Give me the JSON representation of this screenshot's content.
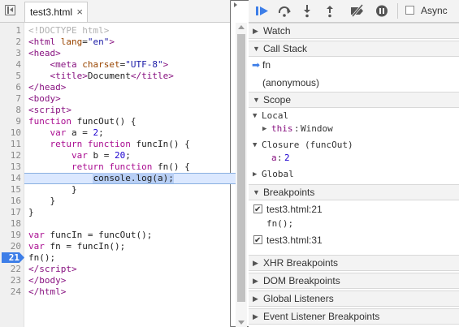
{
  "editor": {
    "tab_label": "test3.html",
    "tab_close": "×",
    "lines": [
      {
        "n": "1",
        "html": "<span class=\"c-comment\">&lt;!DOCTYPE html&gt;</span>"
      },
      {
        "n": "2",
        "html": "<span class=\"c-tag\">&lt;html</span> <span class=\"c-attr\">lang</span>=<span class=\"c-str\">\"en\"</span><span class=\"c-tag\">&gt;</span>"
      },
      {
        "n": "3",
        "html": "<span class=\"c-tag\">&lt;head&gt;</span>"
      },
      {
        "n": "4",
        "html": "    <span class=\"c-tag\">&lt;meta</span> <span class=\"c-attr\">charset</span>=<span class=\"c-str\">\"UTF-8\"</span><span class=\"c-tag\">&gt;</span>"
      },
      {
        "n": "5",
        "html": "    <span class=\"c-tag\">&lt;title&gt;</span>Document<span class=\"c-tag\">&lt;/title&gt;</span>"
      },
      {
        "n": "6",
        "html": "<span class=\"c-tag\">&lt;/head&gt;</span>"
      },
      {
        "n": "7",
        "html": "<span class=\"c-tag\">&lt;body&gt;</span>"
      },
      {
        "n": "8",
        "html": "<span class=\"c-tag\">&lt;script&gt;</span>"
      },
      {
        "n": "9",
        "html": "<span class=\"c-kw\">function</span> funcOut() {"
      },
      {
        "n": "10",
        "html": "    <span class=\"c-kw\">var</span> a = <span class=\"c-num\">2</span>;"
      },
      {
        "n": "11",
        "html": "    <span class=\"c-kw\">return</span> <span class=\"c-kw\">function</span> funcIn() {"
      },
      {
        "n": "12",
        "html": "        <span class=\"c-kw\">var</span> b = <span class=\"c-num\">20</span>;"
      },
      {
        "n": "13",
        "html": "        <span class=\"c-kw\">return</span> <span class=\"c-kw\">function</span> fn() {"
      },
      {
        "n": "14",
        "html": "            <span class=\"sel\">console.log(a);</span>",
        "hl": true
      },
      {
        "n": "15",
        "html": "        }"
      },
      {
        "n": "16",
        "html": "    }"
      },
      {
        "n": "17",
        "html": "}"
      },
      {
        "n": "18",
        "html": ""
      },
      {
        "n": "19",
        "html": "<span class=\"c-kw\">var</span> funcIn = funcOut();"
      },
      {
        "n": "20",
        "html": "<span class=\"c-kw\">var</span> fn = funcIn();"
      },
      {
        "n": "21",
        "html": "fn();",
        "bp": true
      },
      {
        "n": "22",
        "html": "<span class=\"c-tag\">&lt;/script&gt;</span>"
      },
      {
        "n": "23",
        "html": "<span class=\"c-tag\">&lt;/body&gt;</span>"
      },
      {
        "n": "24",
        "html": "<span class=\"c-tag\">&lt;/html&gt;</span>"
      }
    ]
  },
  "toolbar": {
    "async_label": "Async",
    "icons": [
      "resume-icon",
      "step-over-icon",
      "step-into-icon",
      "step-out-icon",
      "deactivate-breakpoints-icon",
      "pause-on-exceptions-icon"
    ]
  },
  "panes": {
    "watch": "Watch",
    "call_stack": "Call Stack",
    "call_stack_frames": [
      "fn",
      "(anonymous)"
    ],
    "scope": "Scope",
    "scope_local": "Local",
    "scope_this_key": "this",
    "scope_this_val": "Window",
    "scope_closure": "Closure (funcOut)",
    "scope_a_key": "a",
    "scope_a_val": "2",
    "scope_global": "Global",
    "breakpoints": "Breakpoints",
    "bp_items": [
      {
        "location": "test3.html:21",
        "code": "fn();"
      },
      {
        "location": "test3.html:31",
        "code": ""
      }
    ],
    "xhr": "XHR Breakpoints",
    "dom": "DOM Breakpoints",
    "global_listeners": "Global Listeners",
    "event_listener": "Event Listener Breakpoints"
  },
  "colors": {
    "accent": "#3d7ee8",
    "highlight_line": "#dbe8ff"
  }
}
